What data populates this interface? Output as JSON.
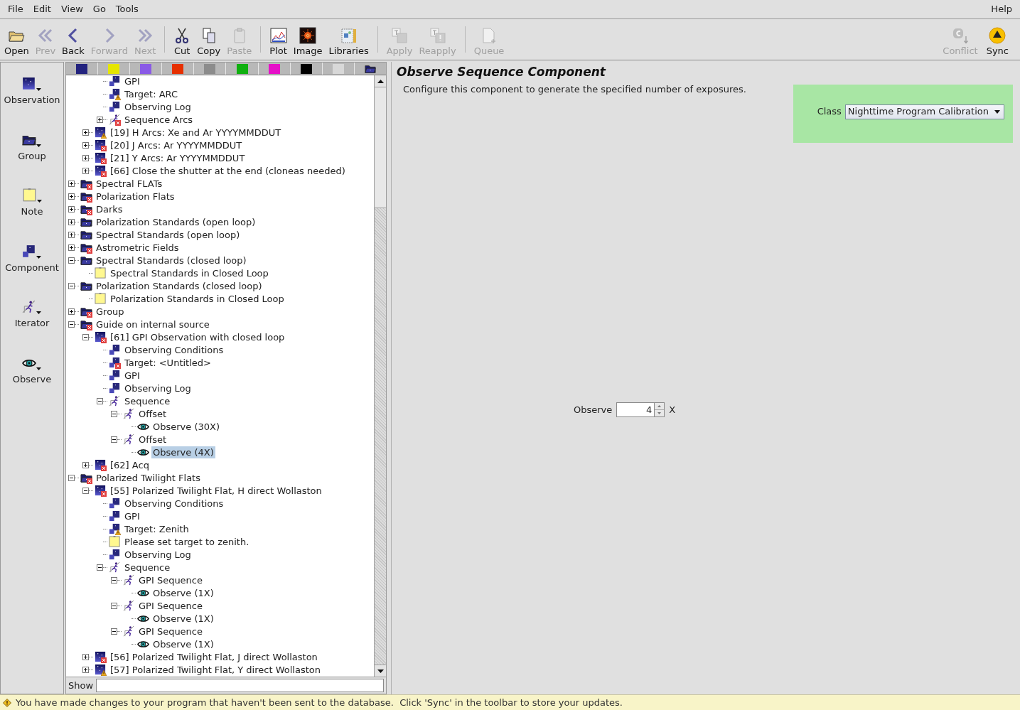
{
  "menu_bar": {
    "left": [
      "File",
      "Edit",
      "View",
      "Go",
      "Tools"
    ],
    "right": [
      "Help"
    ]
  },
  "toolbar": {
    "groups": [
      [
        {
          "kind": "open",
          "label": "Open",
          "enabled": true
        },
        {
          "kind": "prev",
          "label": "Prev",
          "enabled": false
        },
        {
          "kind": "back",
          "label": "Back",
          "enabled": true
        },
        {
          "kind": "forward",
          "label": "Forward",
          "enabled": false
        },
        {
          "kind": "next",
          "label": "Next",
          "enabled": false
        }
      ],
      [
        {
          "kind": "cut",
          "label": "Cut",
          "enabled": true
        },
        {
          "kind": "copy",
          "label": "Copy",
          "enabled": true
        },
        {
          "kind": "paste",
          "label": "Paste",
          "enabled": false
        }
      ],
      [
        {
          "kind": "plot",
          "label": "Plot",
          "enabled": true
        },
        {
          "kind": "image",
          "label": "Image",
          "enabled": true
        },
        {
          "kind": "libraries",
          "label": "Libraries",
          "enabled": true
        }
      ],
      [
        {
          "kind": "apply",
          "label": "Apply",
          "enabled": false
        },
        {
          "kind": "reapply",
          "label": "Reapply",
          "enabled": false
        }
      ],
      [
        {
          "kind": "queue",
          "label": "Queue",
          "enabled": false
        }
      ]
    ],
    "right": [
      {
        "kind": "conflict",
        "label": "Conflict",
        "enabled": false
      },
      {
        "kind": "sync",
        "label": "Sync",
        "enabled": true
      }
    ]
  },
  "palette": [
    {
      "kind": "observation",
      "label": "Observation"
    },
    {
      "kind": "group",
      "label": "Group"
    },
    {
      "kind": "note",
      "label": "Note"
    },
    {
      "kind": "component",
      "label": "Component"
    },
    {
      "kind": "iterator",
      "label": "Iterator"
    },
    {
      "kind": "observe",
      "label": "Observe"
    }
  ],
  "swatches": [
    {
      "color": "#23237e"
    },
    {
      "color": "#e6e600"
    },
    {
      "color": "#8a5ae6"
    },
    {
      "color": "#e63000"
    },
    {
      "color": "#8c8c8c"
    },
    {
      "color": "#10b010"
    },
    {
      "color": "#e610c8"
    },
    {
      "color": "#000000"
    },
    {
      "color": "#d8d8d8"
    }
  ],
  "tree": {
    "items": [
      {
        "children": [
          {
            "children": [
              {
                "label": "GPI",
                "kind": "component",
                "error": false,
                "warning": false,
                "selected": false
              },
              {
                "label": "Target: ARC",
                "kind": "component",
                "error": false,
                "warning": true,
                "selected": false
              },
              {
                "label": "Observing Log",
                "kind": "component",
                "error": false,
                "warning": false,
                "selected": false
              },
              {
                "label": "Sequence Arcs",
                "kind": "iterator",
                "error": true,
                "warning": false,
                "expanded": false,
                "selected": false
              }
            ]
          },
          {
            "label": "[19] H Arcs: Xe and Ar YYYYMMDDUT",
            "kind": "observation",
            "error": false,
            "warning": true,
            "expanded": false,
            "selected": false
          },
          {
            "label": "[20] J Arcs: Ar YYYYMMDDUT",
            "kind": "observation",
            "error": true,
            "warning": false,
            "expanded": false,
            "selected": false
          },
          {
            "label": "[21] Y Arcs: Ar YYYYMMDDUT",
            "kind": "observation",
            "error": true,
            "warning": false,
            "expanded": false,
            "selected": false
          },
          {
            "label": "[66] Close the shutter at the end (cloneas needed)",
            "kind": "observation",
            "error": true,
            "warning": false,
            "expanded": false,
            "selected": false
          }
        ]
      },
      {
        "label": "Spectral FLATs",
        "kind": "group",
        "error": true,
        "warning": false,
        "expanded": false,
        "selected": false
      },
      {
        "label": "Polarization Flats",
        "kind": "group",
        "error": true,
        "warning": false,
        "expanded": false,
        "selected": false
      },
      {
        "label": "Darks",
        "kind": "group",
        "error": true,
        "warning": false,
        "expanded": false,
        "selected": false
      },
      {
        "label": "Polarization Standards (open loop)",
        "kind": "group",
        "error": false,
        "warning": false,
        "expanded": false,
        "selected": false
      },
      {
        "label": "Spectral Standards (open loop)",
        "kind": "group",
        "error": false,
        "warning": false,
        "expanded": false,
        "selected": false
      },
      {
        "label": "Astrometric Fields",
        "kind": "group",
        "error": true,
        "warning": false,
        "expanded": false,
        "selected": false
      },
      {
        "label": "Spectral Standards (closed loop)",
        "kind": "group",
        "error": false,
        "warning": false,
        "expanded": true,
        "selected": false,
        "children": [
          {
            "label": "Spectral Standards in Closed Loop",
            "kind": "note",
            "error": false,
            "warning": false,
            "selected": false
          }
        ]
      },
      {
        "label": "Polarization Standards (closed loop)",
        "kind": "group",
        "error": false,
        "warning": false,
        "expanded": true,
        "selected": false,
        "children": [
          {
            "label": "Polarization Standards in Closed Loop",
            "kind": "note",
            "error": false,
            "warning": false,
            "selected": false
          }
        ]
      },
      {
        "label": "Group",
        "kind": "group",
        "error": true,
        "warning": false,
        "expanded": false,
        "selected": false
      },
      {
        "label": "Guide on internal source",
        "kind": "group",
        "error": true,
        "warning": false,
        "expanded": true,
        "selected": false,
        "children": [
          {
            "label": "[61] GPI Observation with closed loop",
            "kind": "observation",
            "error": true,
            "warning": false,
            "expanded": true,
            "selected": false,
            "children": [
              {
                "label": "Observing Conditions",
                "kind": "component",
                "error": false,
                "warning": false,
                "selected": false
              },
              {
                "label": "Target: <Untitled>",
                "kind": "component",
                "error": true,
                "warning": false,
                "selected": false
              },
              {
                "label": "GPI",
                "kind": "component",
                "error": false,
                "warning": false,
                "selected": false
              },
              {
                "label": "Observing Log",
                "kind": "component",
                "error": false,
                "warning": false,
                "selected": false
              },
              {
                "label": "Sequence",
                "kind": "iterator",
                "error": false,
                "warning": false,
                "expanded": true,
                "selected": false,
                "children": [
                  {
                    "label": "Offset",
                    "kind": "iterator",
                    "error": false,
                    "warning": false,
                    "expanded": true,
                    "selected": false,
                    "children": [
                      {
                        "label": "Observe (30X)",
                        "kind": "observe",
                        "error": false,
                        "warning": false,
                        "selected": false
                      }
                    ]
                  },
                  {
                    "label": "Offset",
                    "kind": "iterator",
                    "error": false,
                    "warning": false,
                    "expanded": true,
                    "selected": false,
                    "children": [
                      {
                        "label": "Observe (4X)",
                        "kind": "observe",
                        "error": false,
                        "warning": false,
                        "selected": true
                      }
                    ]
                  }
                ]
              }
            ]
          },
          {
            "label": "[62] Acq",
            "kind": "observation",
            "error": true,
            "warning": false,
            "expanded": false,
            "selected": false
          }
        ]
      },
      {
        "label": "Polarized Twilight Flats",
        "kind": "group",
        "error": true,
        "warning": false,
        "expanded": true,
        "selected": false,
        "children": [
          {
            "label": "[55] Polarized Twilight Flat, H direct Wollaston",
            "kind": "observation",
            "error": true,
            "warning": false,
            "expanded": true,
            "selected": false,
            "children": [
              {
                "label": "Observing Conditions",
                "kind": "component",
                "error": false,
                "warning": false,
                "selected": false
              },
              {
                "label": "GPI",
                "kind": "component",
                "error": false,
                "warning": false,
                "selected": false
              },
              {
                "label": "Target: Zenith",
                "kind": "component",
                "error": false,
                "warning": true,
                "selected": false
              },
              {
                "label": "Please set target to zenith.",
                "kind": "note",
                "error": false,
                "warning": false,
                "selected": false
              },
              {
                "label": "Observing Log",
                "kind": "component",
                "error": false,
                "warning": false,
                "selected": false
              },
              {
                "label": "Sequence",
                "kind": "iterator",
                "error": false,
                "warning": false,
                "expanded": true,
                "selected": false,
                "children": [
                  {
                    "label": "GPI Sequence",
                    "kind": "iterator",
                    "error": false,
                    "warning": false,
                    "expanded": true,
                    "selected": false,
                    "children": [
                      {
                        "label": "Observe (1X)",
                        "kind": "observe",
                        "error": false,
                        "warning": false,
                        "selected": false
                      }
                    ]
                  },
                  {
                    "label": "GPI Sequence",
                    "kind": "iterator",
                    "error": false,
                    "warning": false,
                    "expanded": true,
                    "selected": false,
                    "children": [
                      {
                        "label": "Observe (1X)",
                        "kind": "observe",
                        "error": false,
                        "warning": false,
                        "selected": false
                      }
                    ]
                  },
                  {
                    "label": "GPI Sequence",
                    "kind": "iterator",
                    "error": false,
                    "warning": false,
                    "expanded": true,
                    "selected": false,
                    "children": [
                      {
                        "label": "Observe (1X)",
                        "kind": "observe",
                        "error": false,
                        "warning": false,
                        "selected": false
                      }
                    ]
                  }
                ]
              }
            ]
          },
          {
            "label": "[56] Polarized Twilight Flat, J direct Wollaston",
            "kind": "observation",
            "error": true,
            "warning": false,
            "expanded": false,
            "selected": false
          },
          {
            "label": "[57] Polarized Twilight Flat, Y direct Wollaston",
            "kind": "observation",
            "error": false,
            "warning": true,
            "expanded": false,
            "selected": false
          }
        ]
      }
    ]
  },
  "show_field": {
    "label": "Show"
  },
  "editor": {
    "title": "Observe Sequence Component",
    "description": "Configure this component to generate the specified number of exposures.",
    "class_label": "Class",
    "class_value": "Nighttime Program Calibration",
    "observe_label": "Observe",
    "observe_value": "4",
    "observe_unit": "X"
  },
  "status_bar": {
    "message": "You have made changes to your program that haven't been sent to the database.  Click 'Sync' in the toolbar to store your updates."
  }
}
